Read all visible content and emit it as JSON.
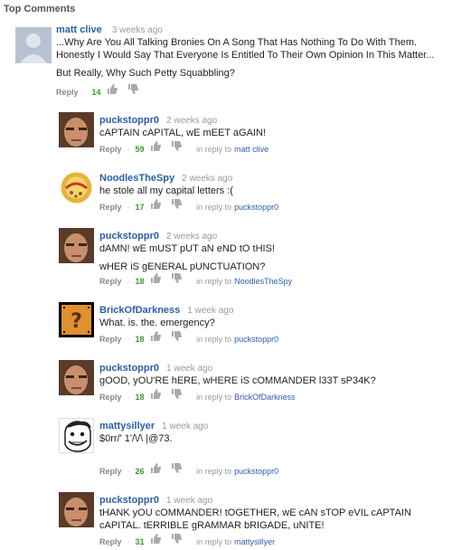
{
  "header": {
    "title": "Top Comments"
  },
  "labels": {
    "reply": "Reply",
    "in_reply_to": "in reply to"
  },
  "comments": [
    {
      "author": "matt clive",
      "time": "3 weeks ago",
      "lines": [
        "...Why Are You All Talking Bronies On A Song That Has Nothing To Do With Them.",
        "Honestly I Would Say That Everyone Is Entitled To Their Own Opinion In This Matter...",
        "But Really, Why Such Petty Squabbling?"
      ],
      "votes": "14",
      "reply_to": ""
    },
    {
      "author": "puckstoppr0",
      "time": "2 weeks ago",
      "lines": [
        "cAPTAIN cAPITAL, wE mEET aGAIN!"
      ],
      "votes": "59",
      "reply_to": "matt clive"
    },
    {
      "author": "NoodlesTheSpy",
      "time": "2 weeks ago",
      "lines": [
        "he stole all my capital letters :("
      ],
      "votes": "17",
      "reply_to": "puckstoppr0"
    },
    {
      "author": "puckstoppr0",
      "time": "2 weeks ago",
      "lines": [
        "dAMN! wE mUST pUT aN eND tO tHIS!",
        "wHER iS gENERAL pUNCTUATION?"
      ],
      "votes": "18",
      "reply_to": "NoodlesTheSpy"
    },
    {
      "author": "BrickOfDarkness",
      "time": "1 week ago",
      "lines": [
        "What. is. the. emergency?"
      ],
      "votes": "18",
      "reply_to": "puckstoppr0"
    },
    {
      "author": "puckstoppr0",
      "time": "1 week ago",
      "lines": [
        "gOOD, yOU'RE hERE, wHERE iS cOMMANDER l33T sP34K?"
      ],
      "votes": "18",
      "reply_to": "BrickOfDarkness"
    },
    {
      "author": "mattysillyer",
      "time": "1 week ago",
      "lines": [
        "$0rr/' 1'/\\/\\ |@73."
      ],
      "votes": "26",
      "reply_to": "puckstoppr0"
    },
    {
      "author": "puckstoppr0",
      "time": "1 week ago",
      "lines": [
        "tHANK yOU cOMMANDER! tOGETHER, wE cAN sTOP eVIL cAPTAIN",
        "cAPITAL. tERRIBLE gRAMMAR bRIGADE, uNITE!"
      ],
      "votes": "31",
      "reply_to": "mattysillyer"
    }
  ]
}
